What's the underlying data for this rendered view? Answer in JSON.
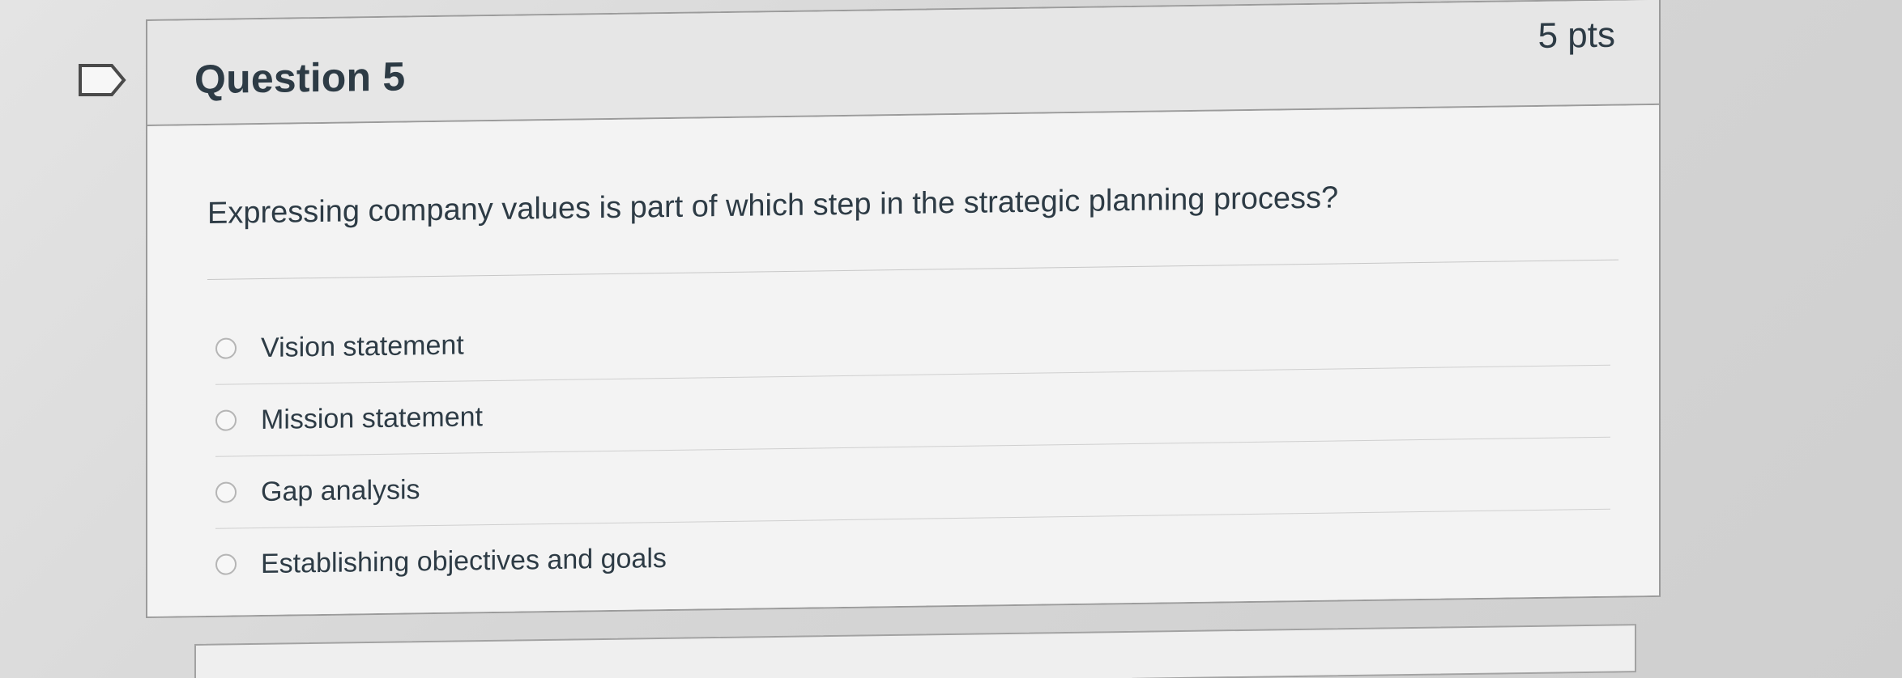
{
  "question": {
    "title": "Question 5",
    "points": "5 pts",
    "text": "Expressing company values is part of which step in the strategic planning process?",
    "answers": [
      {
        "label": "Vision statement",
        "selected": false
      },
      {
        "label": "Mission statement",
        "selected": false
      },
      {
        "label": "Gap analysis",
        "selected": false
      },
      {
        "label": "Establishing objectives and goals",
        "selected": false
      }
    ]
  },
  "icons": {
    "flag": "flag-outline-icon",
    "radio": "radio-unchecked-icon"
  },
  "colors": {
    "text": "#2d3b45",
    "border": "#9b9b9b",
    "header_bg": "#e6e6e6",
    "body_bg": "#f3f3f3"
  }
}
